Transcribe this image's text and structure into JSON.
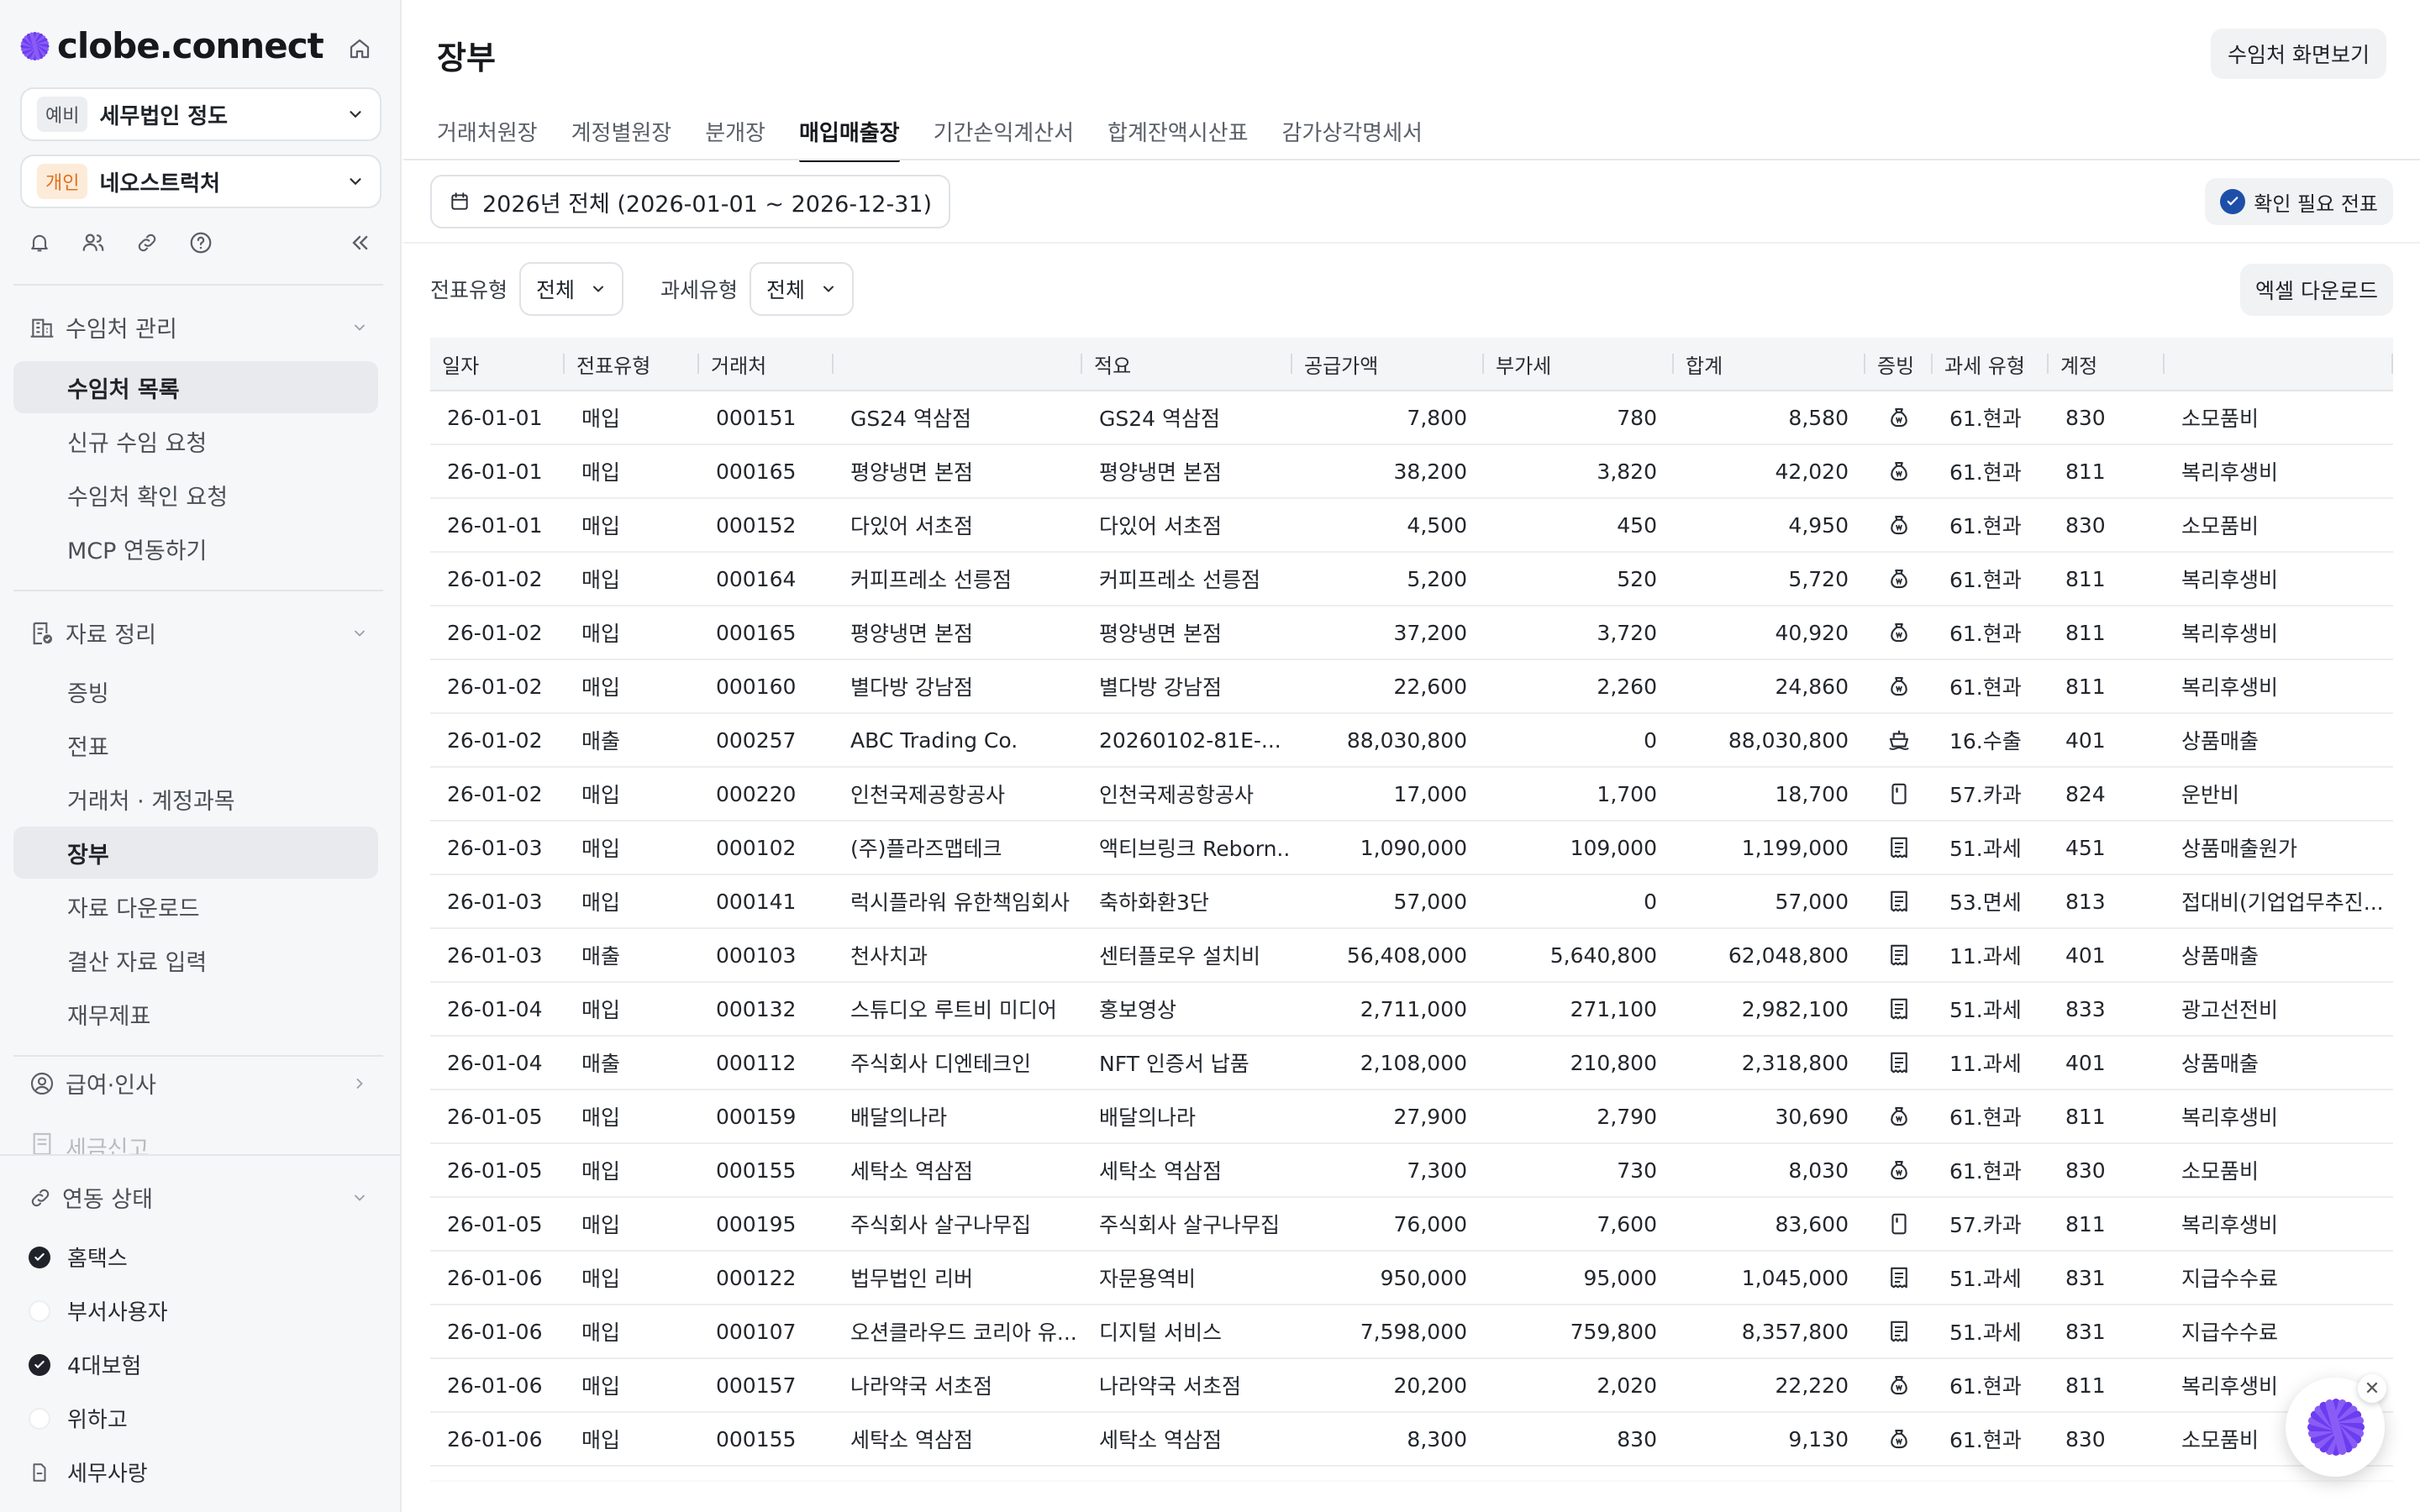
{
  "app": {
    "logo_text": "clobe.connect"
  },
  "sidebar": {
    "firm": {
      "tag": "예비",
      "name": "세무법인 정도"
    },
    "client": {
      "tag": "개인",
      "name": "네오스트럭처"
    },
    "groups": [
      {
        "label": "수임처 관리",
        "items": [
          "수임처 목록",
          "신규 수임 요청",
          "수임처 확인 요청",
          "MCP 연동하기"
        ]
      },
      {
        "label": "자료 정리",
        "items": [
          "증빙",
          "전표",
          "거래처 · 계정과목",
          "장부",
          "자료 다운로드",
          "결산 자료 입력",
          "재무제표"
        ]
      },
      {
        "label": "급여·인사",
        "items": []
      },
      {
        "label": "세금신고",
        "items": []
      }
    ],
    "active_item": "장부",
    "integration": {
      "label": "연동 상태",
      "items": [
        {
          "label": "홈택스",
          "checked": true
        },
        {
          "label": "부서사용자",
          "checked": false
        },
        {
          "label": "4대보험",
          "checked": true
        },
        {
          "label": "위하고",
          "checked": false
        },
        {
          "label": "세무사랑",
          "checked": false
        }
      ]
    }
  },
  "header": {
    "title": "장부",
    "client_view_button": "수임처 화면보기"
  },
  "tabs": [
    "거래처원장",
    "계정별원장",
    "분개장",
    "매입매출장",
    "기간손익계산서",
    "합계잔액시산표",
    "감가상각명세서"
  ],
  "active_tab": "매입매출장",
  "period_button": "2026년 전체 (2026-01-01 ~ 2026-12-31)",
  "confirm_button": "확인 필요 전표",
  "filters": {
    "voucher_type_label": "전표유형",
    "voucher_type_value": "전체",
    "tax_type_label": "과세유형",
    "tax_type_value": "전체"
  },
  "excel_button": "엑셀 다운로드",
  "table": {
    "headers": [
      "일자",
      "전표유형",
      "거래처",
      "",
      "적요",
      "공급가액",
      "부가세",
      "합계",
      "증빙",
      "과세 유형",
      "계정",
      ""
    ],
    "rows": [
      [
        "26-01-01",
        "매입",
        "000151",
        "GS24 역삼점",
        "GS24 역삼점",
        "7,800",
        "780",
        "8,580",
        "receipt",
        "61.현과",
        "830",
        "소모품비"
      ],
      [
        "26-01-01",
        "매입",
        "000165",
        "평양냉면 본점",
        "평양냉면 본점",
        "38,200",
        "3,820",
        "42,020",
        "receipt",
        "61.현과",
        "811",
        "복리후생비"
      ],
      [
        "26-01-01",
        "매입",
        "000152",
        "다있어 서초점",
        "다있어 서초점",
        "4,500",
        "450",
        "4,950",
        "receipt",
        "61.현과",
        "830",
        "소모품비"
      ],
      [
        "26-01-02",
        "매입",
        "000164",
        "커피프레소 선릉점",
        "커피프레소 선릉점",
        "5,200",
        "520",
        "5,720",
        "receipt",
        "61.현과",
        "811",
        "복리후생비"
      ],
      [
        "26-01-02",
        "매입",
        "000165",
        "평양냉면 본점",
        "평양냉면 본점",
        "37,200",
        "3,720",
        "40,920",
        "receipt",
        "61.현과",
        "811",
        "복리후생비"
      ],
      [
        "26-01-02",
        "매입",
        "000160",
        "별다방 강남점",
        "별다방 강남점",
        "22,600",
        "2,260",
        "24,860",
        "receipt",
        "61.현과",
        "811",
        "복리후생비"
      ],
      [
        "26-01-02",
        "매출",
        "000257",
        "ABC Trading Co.",
        "20260102-81E-...",
        "88,030,800",
        "0",
        "88,030,800",
        "ship",
        "16.수출",
        "401",
        "상품매출"
      ],
      [
        "26-01-02",
        "매입",
        "000220",
        "인천국제공항공사",
        "인천국제공항공사",
        "17,000",
        "1,700",
        "18,700",
        "card",
        "57.카과",
        "824",
        "운반비"
      ],
      [
        "26-01-03",
        "매입",
        "000102",
        "(주)플라즈맵테크",
        "액티브링크 Reborn...",
        "1,090,000",
        "109,000",
        "1,199,000",
        "invoice",
        "51.과세",
        "451",
        "상품매출원가"
      ],
      [
        "26-01-03",
        "매입",
        "000141",
        "럭시플라워 유한책임회사",
        "축하화환3단",
        "57,000",
        "0",
        "57,000",
        "invoice",
        "53.면세",
        "813",
        "접대비(기업업무추진..."
      ],
      [
        "26-01-03",
        "매출",
        "000103",
        "천사치과",
        "센터플로우 설치비",
        "56,408,000",
        "5,640,800",
        "62,048,800",
        "invoice",
        "11.과세",
        "401",
        "상품매출"
      ],
      [
        "26-01-04",
        "매입",
        "000132",
        "스튜디오 루트비 미디어",
        "홍보영상",
        "2,711,000",
        "271,100",
        "2,982,100",
        "invoice",
        "51.과세",
        "833",
        "광고선전비"
      ],
      [
        "26-01-04",
        "매출",
        "000112",
        "주식회사 디엔테크인",
        "NFT 인증서 납품",
        "2,108,000",
        "210,800",
        "2,318,800",
        "invoice",
        "11.과세",
        "401",
        "상품매출"
      ],
      [
        "26-01-05",
        "매입",
        "000159",
        "배달의나라",
        "배달의나라",
        "27,900",
        "2,790",
        "30,690",
        "receipt",
        "61.현과",
        "811",
        "복리후생비"
      ],
      [
        "26-01-05",
        "매입",
        "000155",
        "세탁소 역삼점",
        "세탁소 역삼점",
        "7,300",
        "730",
        "8,030",
        "receipt",
        "61.현과",
        "830",
        "소모품비"
      ],
      [
        "26-01-05",
        "매입",
        "000195",
        "주식회사 살구나무집",
        "주식회사 살구나무집",
        "76,000",
        "7,600",
        "83,600",
        "card",
        "57.카과",
        "811",
        "복리후생비"
      ],
      [
        "26-01-06",
        "매입",
        "000122",
        "법무법인 리버",
        "자문용역비",
        "950,000",
        "95,000",
        "1,045,000",
        "invoice",
        "51.과세",
        "831",
        "지급수수료"
      ],
      [
        "26-01-06",
        "매입",
        "000107",
        "오션클라우드 코리아 유...",
        "디지털 서비스",
        "7,598,000",
        "759,800",
        "8,357,800",
        "invoice",
        "51.과세",
        "831",
        "지급수수료"
      ],
      [
        "26-01-06",
        "매입",
        "000157",
        "나라약국 서초점",
        "나라약국 서초점",
        "20,200",
        "2,020",
        "22,220",
        "receipt",
        "61.현과",
        "811",
        "복리후생비"
      ],
      [
        "26-01-06",
        "매입",
        "000155",
        "세탁소 역삼점",
        "세탁소 역삼점",
        "8,300",
        "830",
        "9,130",
        "receipt",
        "61.현과",
        "830",
        "소모품비"
      ]
    ]
  },
  "colors": {
    "accent": "#6a3df0",
    "confirm_badge": "#1e4fa8",
    "active_nav_bg": "#e8eaed"
  }
}
